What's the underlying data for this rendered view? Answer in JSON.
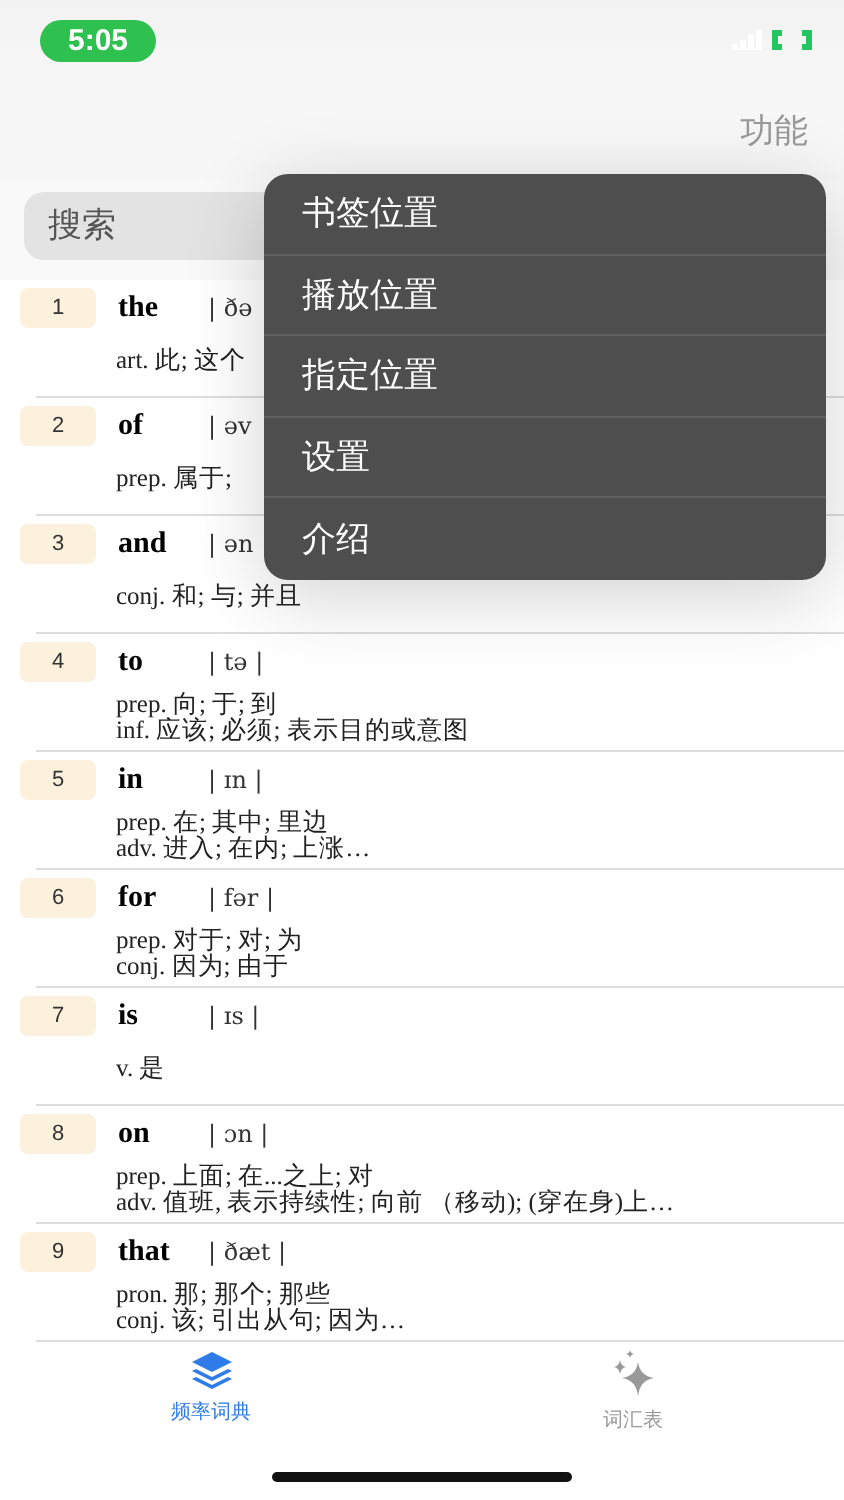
{
  "status_bar": {
    "time": "5:05"
  },
  "header": {
    "action": "功能"
  },
  "search": {
    "placeholder": "搜索"
  },
  "menu": {
    "items": [
      {
        "label": "书签位置"
      },
      {
        "label": "播放位置"
      },
      {
        "label": "指定位置"
      },
      {
        "label": "设置"
      },
      {
        "label": "介绍"
      }
    ]
  },
  "words": [
    {
      "rank": "1",
      "word": "the",
      "phonetic": "| ðə",
      "meanings": [
        "art. 此; 这个"
      ]
    },
    {
      "rank": "2",
      "word": "of",
      "phonetic": "| əv",
      "meanings": [
        "prep. 属于;"
      ]
    },
    {
      "rank": "3",
      "word": "and",
      "phonetic": "| ən",
      "meanings": [
        "conj. 和; 与; 并且"
      ]
    },
    {
      "rank": "4",
      "word": "to",
      "phonetic": "| tə |",
      "meanings": [
        "prep. 向; 于; 到",
        "inf. 应该; 必须; 表示目的或意图"
      ]
    },
    {
      "rank": "5",
      "word": "in",
      "phonetic": "| ɪn |",
      "meanings": [
        "prep. 在; 其中; 里边",
        "adv. 进入; 在内; 上涨…"
      ]
    },
    {
      "rank": "6",
      "word": "for",
      "phonetic": "| fər |",
      "meanings": [
        "prep. 对于; 对; 为",
        "conj. 因为; 由于"
      ]
    },
    {
      "rank": "7",
      "word": "is",
      "phonetic": "| ɪs |",
      "meanings": [
        "v. 是"
      ]
    },
    {
      "rank": "8",
      "word": "on",
      "phonetic": "| ɔn |",
      "meanings": [
        "prep. 上面; 在...之上; 对",
        "adv. 值班, 表示持续性; 向前 （移动); (穿在身)上…"
      ]
    },
    {
      "rank": "9",
      "word": "that",
      "phonetic": "| ðæt |",
      "meanings": [
        "pron. 那; 那个; 那些",
        "conj. 该; 引出从句; 因为…"
      ]
    }
  ],
  "tab_bar": [
    {
      "label": "频率词典",
      "kind": "layers",
      "selected": true
    },
    {
      "label": "词汇表",
      "kind": "sparkles",
      "selected": false
    }
  ]
}
